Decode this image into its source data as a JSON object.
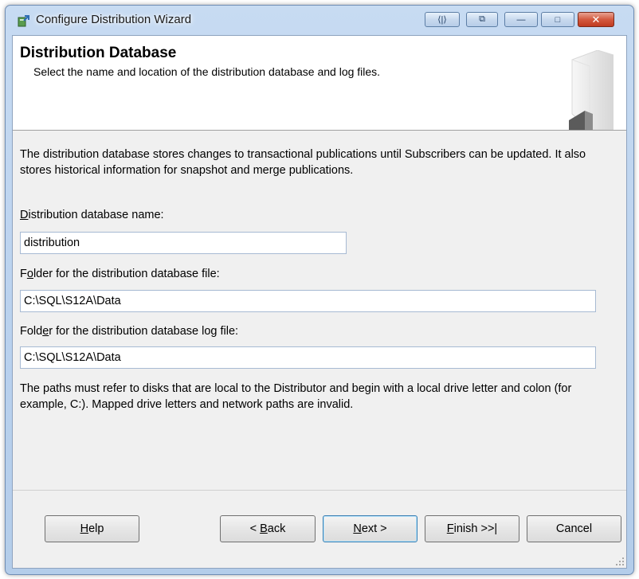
{
  "window": {
    "title": "Configure Distribution Wizard"
  },
  "titlebar_buttons": {
    "nav": "⟨|⟩",
    "pin": "⧉",
    "minimize": "—",
    "maximize": "□",
    "close": "✕"
  },
  "header": {
    "title": "Distribution Database",
    "subtitle": "Select the name and location of the distribution database and log files."
  },
  "description": "The distribution database stores changes to transactional publications until Subscribers can be updated. It also stores historical information for snapshot and merge publications.",
  "fields": {
    "db_name": {
      "label_pre": "",
      "label_key": "D",
      "label_post": "istribution database name:",
      "value": "distribution"
    },
    "data_folder": {
      "label_pre": "F",
      "label_key": "o",
      "label_post": "lder for the distribution database file:",
      "value": "C:\\SQL\\S12A\\Data"
    },
    "log_folder": {
      "label_pre": "Fold",
      "label_key": "e",
      "label_post": "r for the distribution database log file:",
      "value": "C:\\SQL\\S12A\\Data"
    }
  },
  "note": "The paths must refer to disks that are local to the Distributor and begin with a local drive letter and colon (for example, C:). Mapped drive letters and network paths are invalid.",
  "buttons": {
    "help": {
      "pre": "",
      "key": "H",
      "post": "elp"
    },
    "back": {
      "pre": "< ",
      "key": "B",
      "post": "ack"
    },
    "next": {
      "pre": "",
      "key": "N",
      "post": "ext >"
    },
    "finish": {
      "pre": "",
      "key": "F",
      "post": "inish >>|"
    },
    "cancel": {
      "pre": "",
      "key": "",
      "post": "Cancel"
    }
  },
  "colors": {
    "title_bar": "#c7dbf2",
    "close_button": "#c13b20",
    "default_button_border": "#3c7fb1"
  }
}
